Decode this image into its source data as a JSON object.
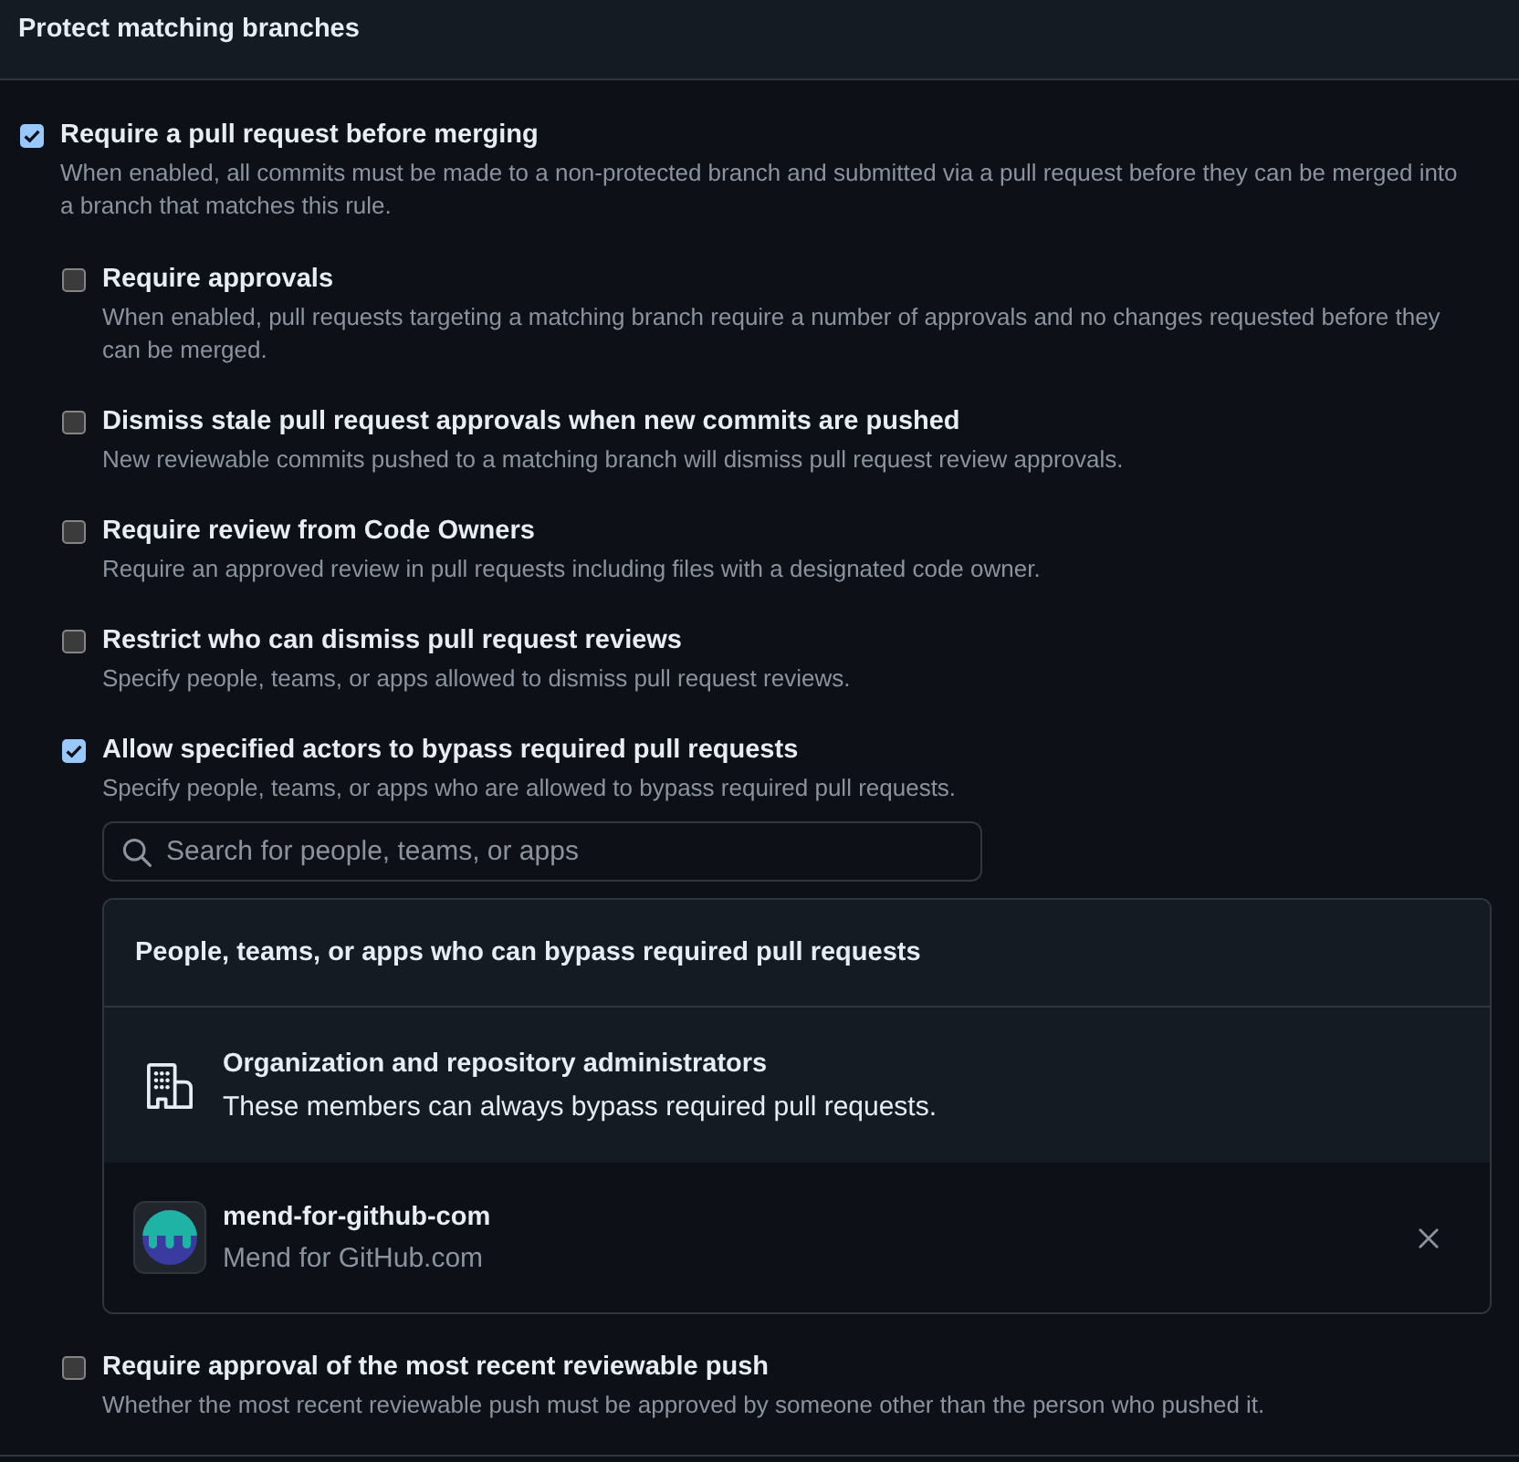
{
  "section": {
    "title": "Protect matching branches"
  },
  "rule": {
    "label": "Require a pull request before merging",
    "checked": true,
    "description": "When enabled, all commits must be made to a non-protected branch and submitted via a pull request before they can be merged into a branch that matches this rule.",
    "options": [
      {
        "label": "Require approvals",
        "checked": false,
        "description": "When enabled, pull requests targeting a matching branch require a number of approvals and no changes requested before they can be merged."
      },
      {
        "label": "Dismiss stale pull request approvals when new commits are pushed",
        "checked": false,
        "description": "New reviewable commits pushed to a matching branch will dismiss pull request review approvals."
      },
      {
        "label": "Require review from Code Owners",
        "checked": false,
        "description": "Require an approved review in pull requests including files with a designated code owner."
      },
      {
        "label": "Restrict who can dismiss pull request reviews",
        "checked": false,
        "description": "Specify people, teams, or apps allowed to dismiss pull request reviews."
      },
      {
        "label": "Allow specified actors to bypass required pull requests",
        "checked": true,
        "description": "Specify people, teams, or apps who are allowed to bypass required pull requests.",
        "bypass": {
          "search": {
            "placeholder": "Search for people, teams, or apps"
          },
          "title": "People, teams, or apps who can bypass required pull requests",
          "actors": [
            {
              "kind": "role",
              "name": "Organization and repository administrators",
              "description": "These members can always bypass required pull requests."
            },
            {
              "kind": "app",
              "name": "mend-for-github-com",
              "description": "Mend for GitHub.com"
            }
          ]
        }
      },
      {
        "label": "Require approval of the most recent reviewable push",
        "checked": false,
        "description": "Whether the most recent reviewable push must be approved by someone other than the person who pushed it."
      }
    ]
  }
}
